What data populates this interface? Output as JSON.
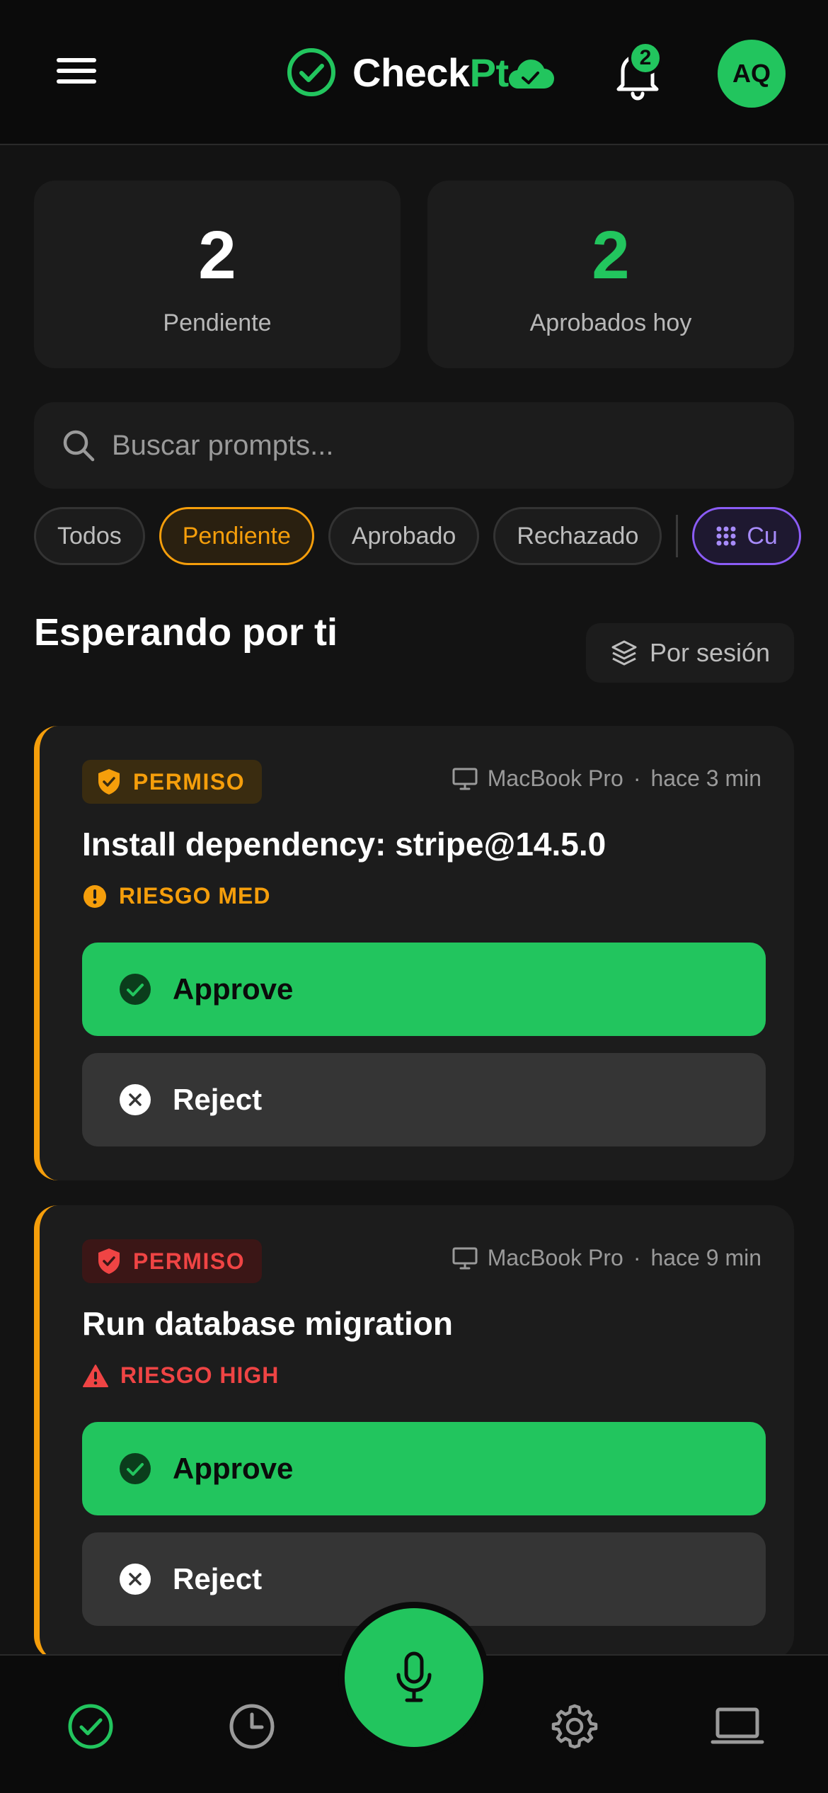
{
  "header": {
    "logo_check": "Check",
    "logo_pt": "Pt",
    "notification_count": "2",
    "avatar_initials": "AQ"
  },
  "stats": [
    {
      "value": "2",
      "label": "Pendiente",
      "color": "#ffffff"
    },
    {
      "value": "2",
      "label": "Aprobados hoy",
      "color": "#22c55e"
    }
  ],
  "search": {
    "placeholder": "Buscar prompts..."
  },
  "filters": {
    "items": [
      {
        "label": "Todos",
        "active": false
      },
      {
        "label": "Pendiente",
        "active": true
      },
      {
        "label": "Aprobado",
        "active": false
      },
      {
        "label": "Rechazado",
        "active": false
      }
    ],
    "custom_label": "Cu"
  },
  "section": {
    "title": "Esperando por ti",
    "group_label": "Por sesión"
  },
  "cards": [
    {
      "type": "PERMISO",
      "device": "MacBook Pro",
      "separator": "·",
      "time": "hace 3 min",
      "title": "Install dependency: stripe@14.5.0",
      "risk": "RIESGO MED",
      "approve_label": "Approve",
      "reject_label": "Reject"
    },
    {
      "type": "PERMISO",
      "device": "MacBook Pro",
      "separator": "·",
      "time": "hace 9 min",
      "title": "Run database migration",
      "risk": "RIESGO HIGH",
      "approve_label": "Approve",
      "reject_label": "Reject"
    }
  ],
  "colors": {
    "accent": "#22c55e",
    "warning": "#f59e0b",
    "danger": "#ef4444",
    "custom": "#8b5cf6",
    "background": "#131313",
    "surface": "#1c1c1c"
  },
  "icons": {
    "menu": "hamburger-icon",
    "logo": "check-circle-icon",
    "cloud": "cloud-check-icon",
    "notifications": "bell-icon",
    "search": "search-icon",
    "custom_filter": "grid-icon",
    "group": "layers-icon",
    "device": "monitor-icon",
    "approve": "check-circle-icon",
    "reject": "x-circle-icon",
    "nav": [
      "check-circle-icon",
      "clock-icon",
      "microphone-icon",
      "gear-icon",
      "laptop-icon"
    ]
  }
}
